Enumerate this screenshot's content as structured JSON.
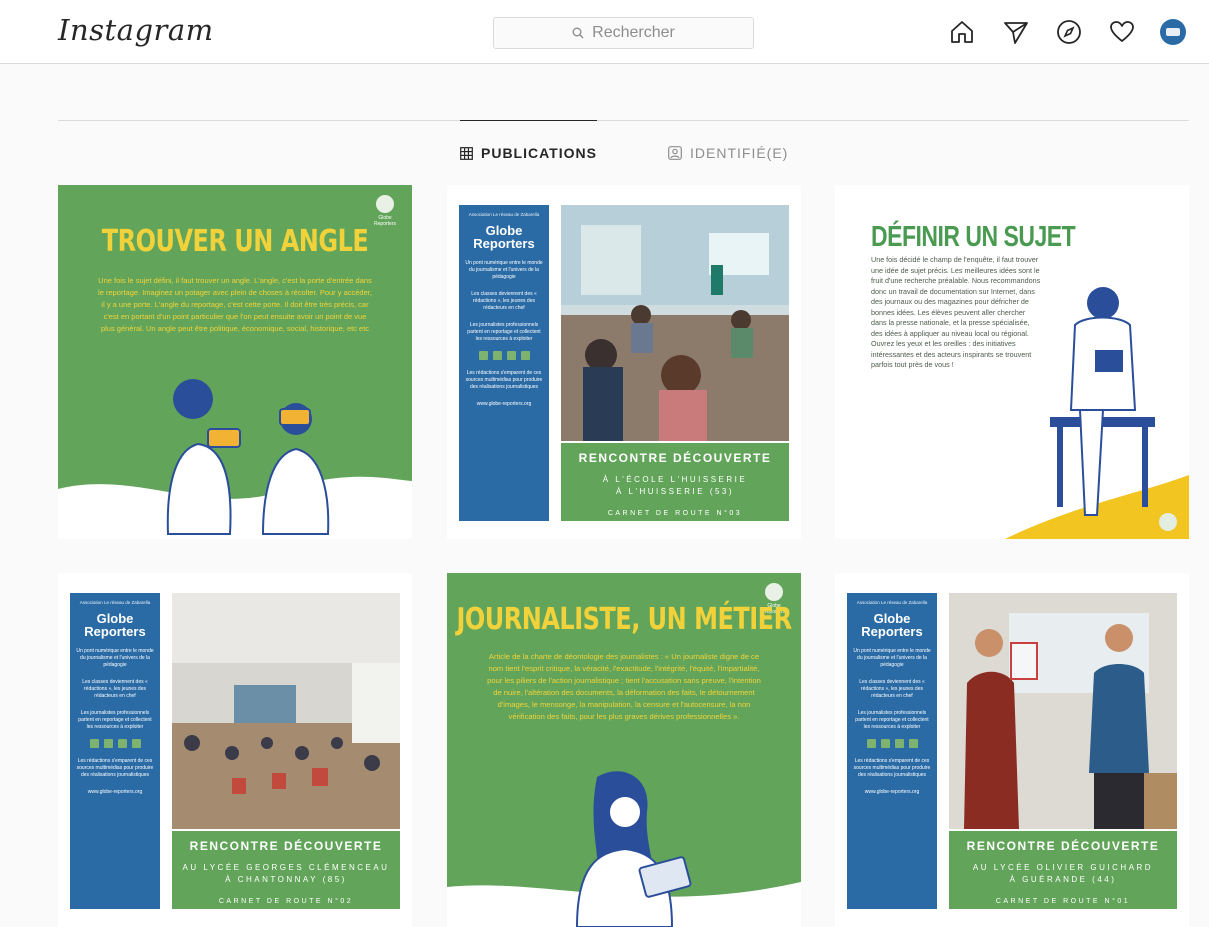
{
  "header": {
    "logo": "Instagram",
    "search_placeholder": "Rechercher",
    "nav_icons": [
      "home-icon",
      "paper-plane-icon",
      "compass-icon",
      "heart-icon",
      "avatar"
    ]
  },
  "tabs": [
    {
      "label": "PUBLICATIONS",
      "icon": "grid-icon",
      "active": true
    },
    {
      "label": "IDENTIFIÉ(E)",
      "icon": "tag-user-icon",
      "active": false
    }
  ],
  "colors": {
    "green": "#62a55a",
    "yellow": "#f2d23a",
    "blue": "#2a6ba6"
  },
  "posts": {
    "p1": {
      "title": "TROUVER UN ANGLE",
      "body": "Une fois le sujet défini, il faut trouver un angle. L'angle, c'est la porte d'entrée dans le reportage. Imaginez un potager avec plein de choses à récolter. Pour y accéder, il y a une porte. L'angle du reportage, c'est cette porte. Il doit être très précis, car c'est en portant d'un point particulier que l'on peut ensuite avoir un point de vue plus général. Un angle peut être politique, économique, social, historique, etc etc",
      "logo_caption": "Globe Reporters"
    },
    "side": {
      "assoc": "Association Le réseau de Zabarella",
      "brand_1": "Globe",
      "brand_2": "Reporters",
      "b1": "Un pont numérique entre le monde du journalisme et l'univers de la pédagogie",
      "b2": "Les classes deviennent des « rédactions », les jeunes des rédacteurs en chef",
      "b3": "Les journalistes professionnels partent en reportage et collectent les ressources à exploiter",
      "b4": "Les rédactions s'emparent de ces sources multimédias pour produire des réalisations journalistiques",
      "site": "www.globe-reporters.org"
    },
    "p2": {
      "t1": "RENCONTRE DÉCOUVERTE",
      "t2a": "À L'ÉCOLE L'HUISSERIE",
      "t2b": "À L'HUISSERIE (53)",
      "t3": "CARNET DE ROUTE N°03"
    },
    "p3": {
      "title": "DÉFINIR UN SUJET",
      "body": "Une fois décidé le champ de l'enquête, il faut trouver une idée de sujet précis. Les meilleures idées sont le fruit d'une recherche préalable. Nous recommandons donc un travail de documentation sur Internet, dans des journaux ou des magazines pour défricher de bonnes idées. Les élèves peuvent aller chercher dans la presse nationale, et la presse spécialisée, des idées à appliquer au niveau local ou régional. Ouvrez les yeux et les oreilles : des initiatives intéressantes et des acteurs inspirants se trouvent parfois tout près de vous !"
    },
    "p4": {
      "t1": "RENCONTRE DÉCOUVERTE",
      "t2a": "AU LYCÉE GEORGES CLÉMENCEAU",
      "t2b": "À CHANTONNAY (85)",
      "t3": "CARNET DE ROUTE N°02"
    },
    "p5": {
      "title": "JOURNALISTE, UN MÉTIER",
      "body": "Article de la charte de déontologie des journalistes : « Un journaliste digne de ce nom tient l'esprit critique, la véracité, l'exactitude, l'intégrité, l'équité, l'impartialité, pour les piliers de l'action journalistique ; tient l'accusation sans preuve, l'intention de nuire, l'altération des documents, la déformation des faits, le détournement d'images, le mensonge, la manipulation, la censure et l'autocensure, la non vérification des faits, pour les plus graves dérives professionnelles »."
    },
    "p6": {
      "t1": "RENCONTRE DÉCOUVERTE",
      "t2a": "AU LYCÉE OLIVIER GUICHARD",
      "t2b": "À GUÉRANDE (44)",
      "t3": "CARNET DE ROUTE N°01"
    }
  }
}
